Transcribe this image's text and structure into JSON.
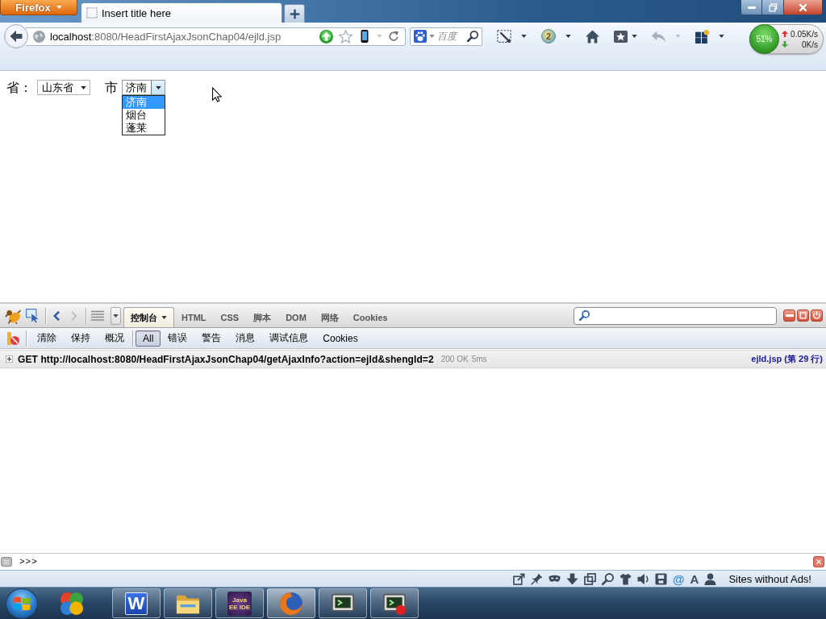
{
  "browser": {
    "menu_button": "Firefox",
    "tabs": [
      {
        "title": "Insert title here",
        "selected": true
      }
    ],
    "address": {
      "host": "localhost",
      "path": ":8080/HeadFirstAjaxJsonChap04/ejld.jsp"
    },
    "search": {
      "placeholder": "百度"
    },
    "extension_counter": "2",
    "network_meter": {
      "usage": "51%",
      "upload": "0.05K/s",
      "download": "0K/s"
    }
  },
  "page": {
    "province": {
      "label": "省：",
      "value": "山东省"
    },
    "city": {
      "label": "市",
      "value": "济南",
      "expanded": true,
      "options": [
        {
          "label": "济南",
          "selected": true
        },
        {
          "label": "烟台",
          "selected": false
        },
        {
          "label": "蓬莱",
          "selected": false
        }
      ]
    }
  },
  "firebug": {
    "panels": [
      {
        "label": "控制台",
        "selected": true
      },
      {
        "label": "HTML",
        "selected": false
      },
      {
        "label": "CSS",
        "selected": false
      },
      {
        "label": "脚本",
        "selected": false
      },
      {
        "label": "DOM",
        "selected": false
      },
      {
        "label": "网络",
        "selected": false
      },
      {
        "label": "Cookies",
        "selected": false
      }
    ],
    "console_actions": [
      "清除",
      "保持",
      "概况"
    ],
    "console_filters": [
      {
        "label": "All",
        "selected": true
      },
      {
        "label": "错误",
        "selected": false
      },
      {
        "label": "警告",
        "selected": false
      },
      {
        "label": "消息",
        "selected": false
      },
      {
        "label": "调试信息",
        "selected": false
      },
      {
        "label": "Cookies",
        "selected": false
      }
    ],
    "log": [
      {
        "expanded": false,
        "request": "GET http://localhost:8080/HeadFirstAjaxJsonChap04/getAjaxInfo?action=ejld&shengId=2",
        "status": "200 OK",
        "time": "5ms",
        "source": "ejld.jsp (第 29 行)"
      }
    ],
    "command_prompt": ">>>"
  },
  "addon_bar": {
    "glyph_icons": [
      "@",
      "A"
    ],
    "text": "Sites without Ads!"
  },
  "taskbar": {
    "items": [
      {
        "kind": "pinwheel",
        "running": false,
        "selected": false
      },
      {
        "kind": "letter",
        "label": "W",
        "running": true,
        "selected": false
      },
      {
        "kind": "folder",
        "running": true,
        "selected": false
      },
      {
        "kind": "ide",
        "label": "Java EE IDE",
        "running": true,
        "selected": false
      },
      {
        "kind": "browser",
        "running": true,
        "selected": true
      },
      {
        "kind": "terminal",
        "running": true,
        "selected": false
      },
      {
        "kind": "terminal-stop",
        "running": true,
        "selected": false
      }
    ]
  }
}
